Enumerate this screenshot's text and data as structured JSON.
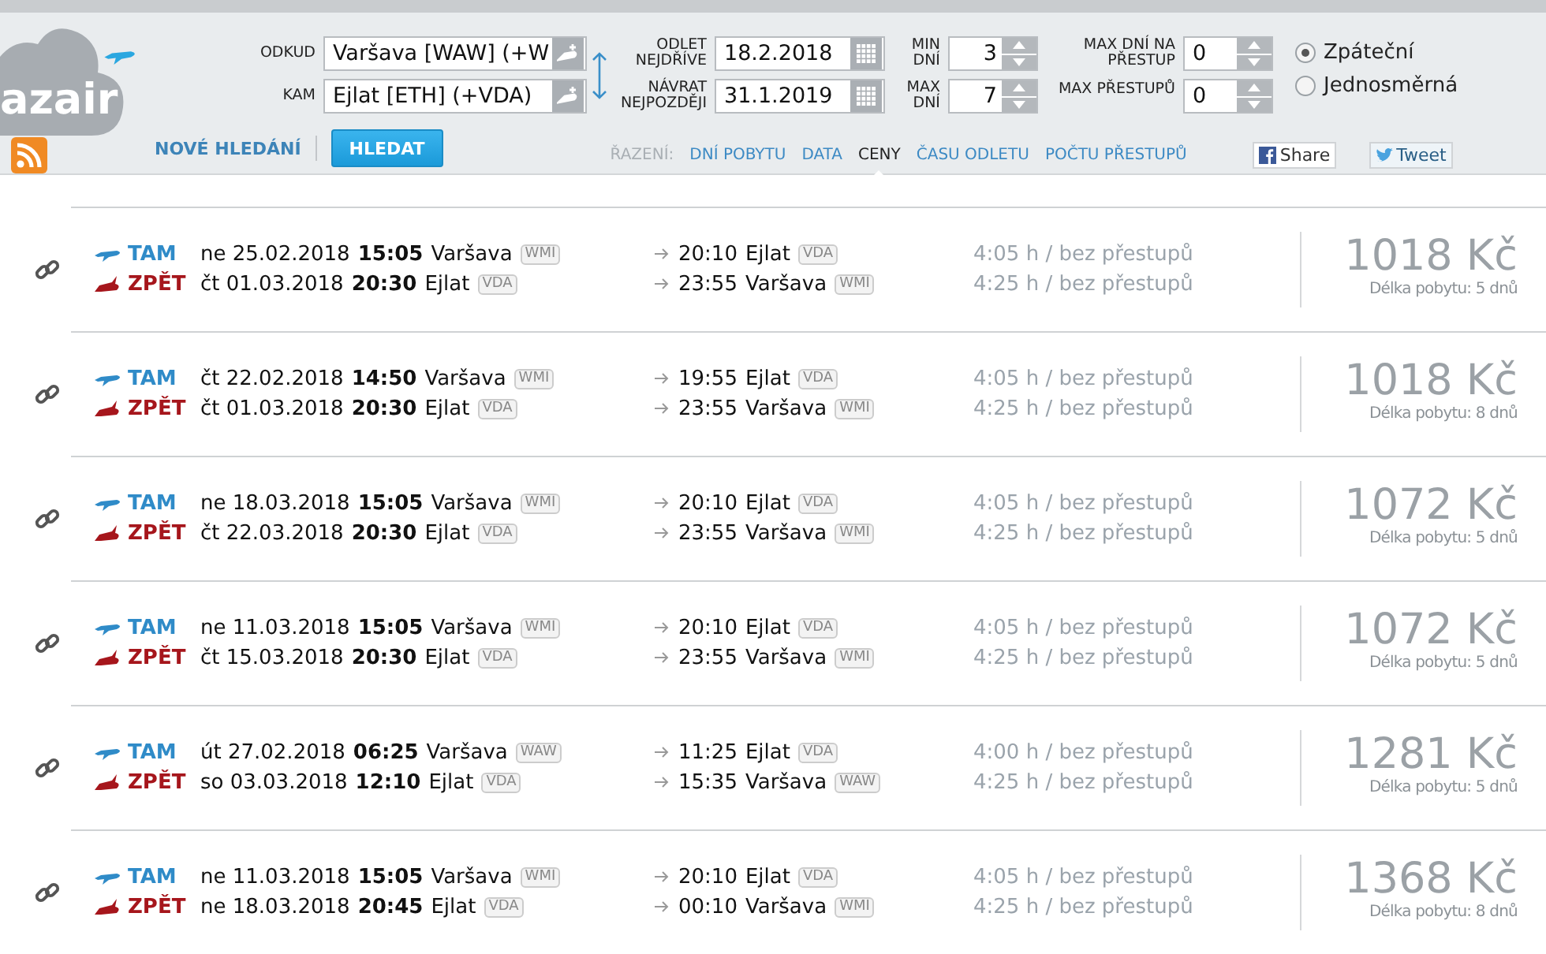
{
  "logo": {
    "text": "azair"
  },
  "search": {
    "from": {
      "label": "ODKUD",
      "value": "Varšava [WAW] (+W"
    },
    "to": {
      "label": "KAM",
      "value": "Ejlat [ETH] (+VDA)"
    },
    "depart": {
      "label": "ODLET NEJDŘÍVE",
      "value": "18.2.2018"
    },
    "return": {
      "label": "NÁVRAT NEJPOZDĚJI",
      "value": "31.1.2019"
    },
    "min_days": {
      "label": "MIN DNÍ",
      "value": "3"
    },
    "max_days": {
      "label": "MAX DNÍ",
      "value": "7"
    },
    "max_stop_days": {
      "label": "MAX DNÍ NA PŘESTUP",
      "value": "0"
    },
    "max_stops": {
      "label": "MAX PŘESTUPŮ",
      "value": "0"
    },
    "trip_types": [
      {
        "label": "Zpáteční",
        "selected": true
      },
      {
        "label": "Jednosměrná",
        "selected": false
      }
    ],
    "new_search": "NOVÉ HLEDÁNÍ",
    "submit": "HLEDAT"
  },
  "sort": {
    "label": "ŘAZENÍ:",
    "tabs": [
      {
        "label": "DNÍ POBYTU",
        "selected": false
      },
      {
        "label": "DATA",
        "selected": false
      },
      {
        "label": "CENY",
        "selected": true
      },
      {
        "label": "ČASU ODLETU",
        "selected": false
      },
      {
        "label": "POČTU PŘESTUPŮ",
        "selected": false
      }
    ]
  },
  "share": {
    "facebook": "Share",
    "twitter": "Tweet"
  },
  "results": [
    {
      "price": "1018 Kč",
      "stay": "Délka pobytu: 5 dnů",
      "legs": [
        {
          "kind": "out",
          "label": "TAM",
          "date": "ne 25.02.2018",
          "time": "15:05",
          "city": "Varšava",
          "code": "WMI",
          "arr_time": "20:10",
          "arr_city": "Ejlat",
          "arr_code": "VDA",
          "duration": "4:05 h / bez přestupů"
        },
        {
          "kind": "back",
          "label": "ZPĚT",
          "date": "čt 01.03.2018",
          "time": "20:30",
          "city": "Ejlat",
          "code": "VDA",
          "arr_time": "23:55",
          "arr_city": "Varšava",
          "arr_code": "WMI",
          "duration": "4:25 h / bez přestupů"
        }
      ]
    },
    {
      "price": "1018 Kč",
      "stay": "Délka pobytu: 8 dnů",
      "legs": [
        {
          "kind": "out",
          "label": "TAM",
          "date": "čt 22.02.2018",
          "time": "14:50",
          "city": "Varšava",
          "code": "WMI",
          "arr_time": "19:55",
          "arr_city": "Ejlat",
          "arr_code": "VDA",
          "duration": "4:05 h / bez přestupů"
        },
        {
          "kind": "back",
          "label": "ZPĚT",
          "date": "čt 01.03.2018",
          "time": "20:30",
          "city": "Ejlat",
          "code": "VDA",
          "arr_time": "23:55",
          "arr_city": "Varšava",
          "arr_code": "WMI",
          "duration": "4:25 h / bez přestupů"
        }
      ]
    },
    {
      "price": "1072 Kč",
      "stay": "Délka pobytu: 5 dnů",
      "legs": [
        {
          "kind": "out",
          "label": "TAM",
          "date": "ne 18.03.2018",
          "time": "15:05",
          "city": "Varšava",
          "code": "WMI",
          "arr_time": "20:10",
          "arr_city": "Ejlat",
          "arr_code": "VDA",
          "duration": "4:05 h / bez přestupů"
        },
        {
          "kind": "back",
          "label": "ZPĚT",
          "date": "čt 22.03.2018",
          "time": "20:30",
          "city": "Ejlat",
          "code": "VDA",
          "arr_time": "23:55",
          "arr_city": "Varšava",
          "arr_code": "WMI",
          "duration": "4:25 h / bez přestupů"
        }
      ]
    },
    {
      "price": "1072 Kč",
      "stay": "Délka pobytu: 5 dnů",
      "legs": [
        {
          "kind": "out",
          "label": "TAM",
          "date": "ne 11.03.2018",
          "time": "15:05",
          "city": "Varšava",
          "code": "WMI",
          "arr_time": "20:10",
          "arr_city": "Ejlat",
          "arr_code": "VDA",
          "duration": "4:05 h / bez přestupů"
        },
        {
          "kind": "back",
          "label": "ZPĚT",
          "date": "čt 15.03.2018",
          "time": "20:30",
          "city": "Ejlat",
          "code": "VDA",
          "arr_time": "23:55",
          "arr_city": "Varšava",
          "arr_code": "WMI",
          "duration": "4:25 h / bez přestupů"
        }
      ]
    },
    {
      "price": "1281 Kč",
      "stay": "Délka pobytu: 5 dnů",
      "legs": [
        {
          "kind": "out",
          "label": "TAM",
          "date": "út 27.02.2018",
          "time": "06:25",
          "city": "Varšava",
          "code": "WAW",
          "arr_time": "11:25",
          "arr_city": "Ejlat",
          "arr_code": "VDA",
          "duration": "4:00 h / bez přestupů"
        },
        {
          "kind": "back",
          "label": "ZPĚT",
          "date": "so 03.03.2018",
          "time": "12:10",
          "city": "Ejlat",
          "code": "VDA",
          "arr_time": "15:35",
          "arr_city": "Varšava",
          "arr_code": "WAW",
          "duration": "4:25 h / bez přestupů"
        }
      ]
    },
    {
      "price": "1368 Kč",
      "stay": "Délka pobytu: 8 dnů",
      "legs": [
        {
          "kind": "out",
          "label": "TAM",
          "date": "ne 11.03.2018",
          "time": "15:05",
          "city": "Varšava",
          "code": "WMI",
          "arr_time": "20:10",
          "arr_city": "Ejlat",
          "arr_code": "VDA",
          "duration": "4:05 h / bez přestupů"
        },
        {
          "kind": "back",
          "label": "ZPĚT",
          "date": "ne 18.03.2018",
          "time": "20:45",
          "city": "Ejlat",
          "code": "VDA",
          "arr_time": "00:10",
          "arr_city": "Varšava",
          "arr_code": "WMI",
          "duration": "4:25 h / bez přestupů"
        }
      ]
    }
  ]
}
